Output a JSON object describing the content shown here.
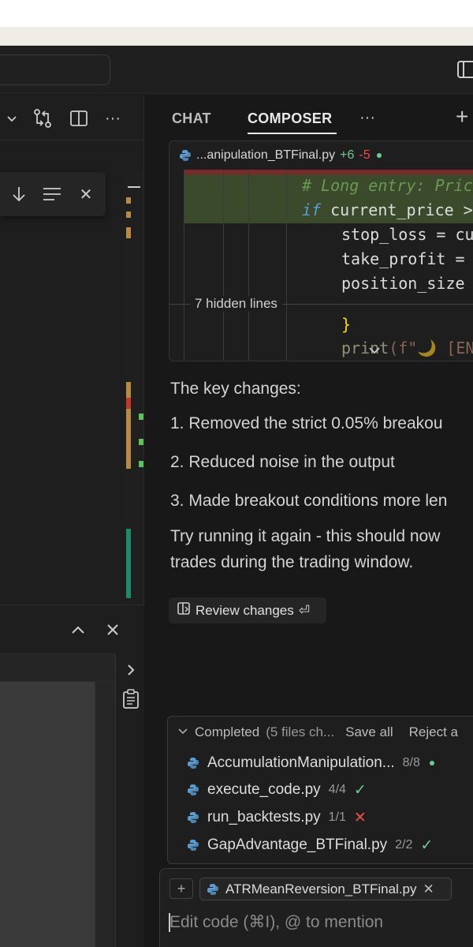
{
  "chat_tabs": {
    "chat": "CHAT",
    "composer": "COMPOSER",
    "more": "···",
    "new": "+"
  },
  "diff": {
    "filename": "...anipulation_BTFinal.py",
    "additions": "+6",
    "deletions": "-5",
    "lines": {
      "comment": "# Long entry: Pric",
      "if_kw": "if",
      "if_rest": " current_price >",
      "stop_loss": "stop_loss = cu",
      "take_profit": "take_profit =",
      "position_size": "position_size",
      "brace": "}",
      "print_fn": "print",
      "print_args": "(f\"🌙 [EN"
    },
    "hidden_lines": "7 hidden lines"
  },
  "message": {
    "intro": "The key changes:",
    "item1": "1. Removed the strict 0.05% breakou",
    "item2": "2. Reduced noise in the output",
    "item3": "3. Made breakout conditions more len",
    "outro_line1": "Try running it again - this should now",
    "outro_line2": "trades during the trading window."
  },
  "review_button": "Review changes",
  "review_shortcut": "⏎",
  "completed": {
    "label": "Completed",
    "summary": "(5 files ch...",
    "save_all": "Save all",
    "reject": "Reject a",
    "files": [
      {
        "name": "AccumulationManipulation...",
        "count": "8/8",
        "status": "dot"
      },
      {
        "name": "execute_code.py",
        "count": "4/4",
        "status": "✓"
      },
      {
        "name": "run_backtests.py",
        "count": "1/1",
        "status": "✕"
      },
      {
        "name": "GapAdvantage_BTFinal.py",
        "count": "2/2",
        "status": "✓"
      }
    ]
  },
  "composer_input": {
    "add": "+",
    "context_file": "ATRMeanReversion_BTFinal.py",
    "context_close": "✕",
    "placeholder": "Edit code (⌘I), @ to mention"
  },
  "left_panel": {
    "toolbar_more": "···",
    "find_close": "✕"
  },
  "colors": {
    "accent_green": "#73c991",
    "accent_red": "#f14c4c",
    "background": "#181818"
  }
}
